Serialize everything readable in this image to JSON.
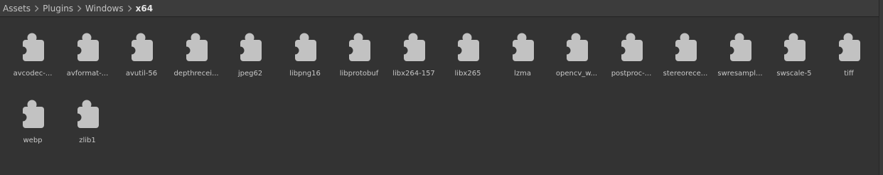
{
  "breadcrumb": [
    {
      "label": "Assets",
      "current": false
    },
    {
      "label": "Plugins",
      "current": false
    },
    {
      "label": "Windows",
      "current": false
    },
    {
      "label": "x64",
      "current": true
    }
  ],
  "icon_name": "plugin-puzzle-icon",
  "colors": {
    "background": "#333333",
    "icon": "#c2c2c2",
    "icon_hole": "#333333",
    "text": "#c8c8c8",
    "breadcrumb_bar": "#3c3c3c"
  },
  "files": [
    "avcodec-...",
    "avformat-...",
    "avutil-56",
    "depthrecei...",
    "jpeg62",
    "libpng16",
    "libprotobuf",
    "libx264-157",
    "libx265",
    "lzma",
    "opencv_w...",
    "postproc-...",
    "stereorece...",
    "swresampl...",
    "swscale-5",
    "tiff",
    "webp",
    "zlib1"
  ]
}
